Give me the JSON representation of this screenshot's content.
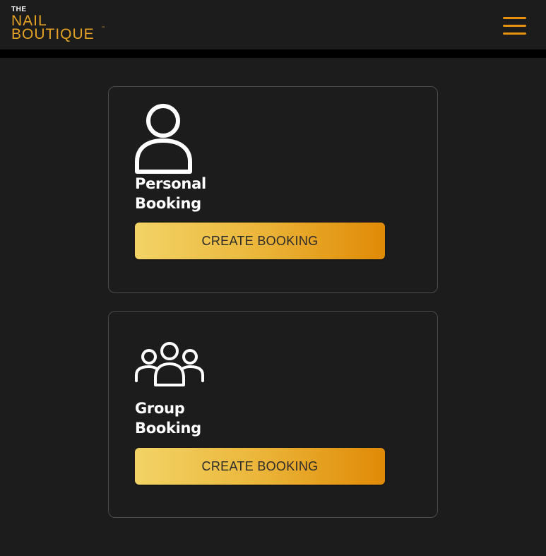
{
  "brand": {
    "line1": "THE",
    "line2": "NAIL",
    "line3": "BOUTIQUE",
    "trademark": "™",
    "accent_color": "#e6a223"
  },
  "header": {
    "menu_icon": "hamburger-menu-icon"
  },
  "cards": [
    {
      "icon": "person-icon",
      "title": "Personal\nBooking",
      "button_label": "CREATE BOOKING"
    },
    {
      "icon": "group-icon",
      "title": "Group\nBooking",
      "button_label": "CREATE BOOKING"
    }
  ],
  "colors": {
    "background": "#1c1c1c",
    "card_border": "#4a4a4a",
    "button_gradient_start": "#f2d366",
    "button_gradient_end": "#e08a06"
  }
}
